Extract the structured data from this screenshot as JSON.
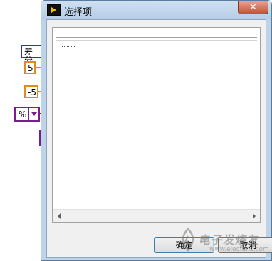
{
  "background": {
    "diff_label": "差分",
    "num_value_a": "5",
    "num_value_b": "-5",
    "enum_value": "%"
  },
  "dialog": {
    "title": "选择项",
    "close_glyph": "✕",
    "list_items": [],
    "ok_label": "确定",
    "cancel_label": "取消"
  },
  "watermark": {
    "line1": "电子发烧友",
    "line2": "www.elecfans.com"
  },
  "colors": {
    "title_bar": "#cfe0f2",
    "close_button": "#c7503d",
    "diagram_blue": "#2b2fd1",
    "diagram_orange": "#e08b20",
    "diagram_purple": "#7a1b8f"
  },
  "icons": {
    "app": "labview-run-icon",
    "close": "close-icon",
    "scroll_left": "scroll-left-arrow-icon",
    "scroll_right": "scroll-right-arrow-icon",
    "enum_dropdown": "chevron-down-icon"
  }
}
